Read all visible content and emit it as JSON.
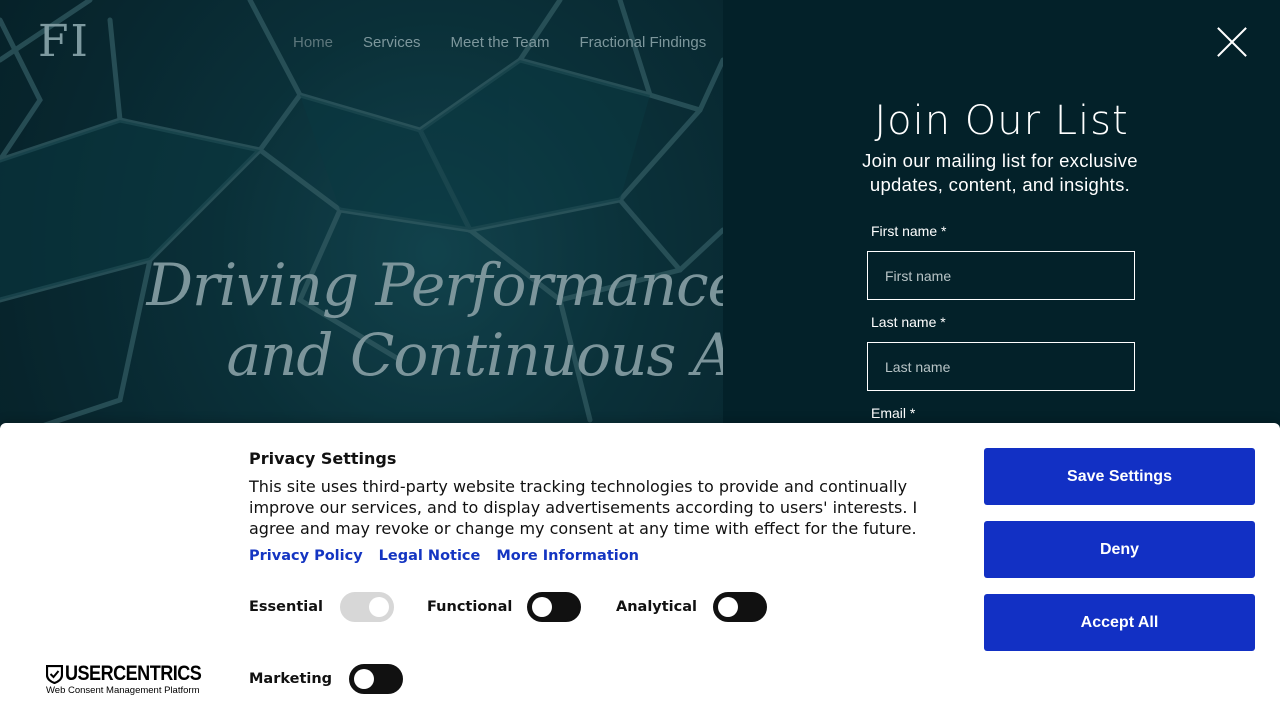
{
  "site": {
    "logo_text": "FI",
    "nav": [
      "Home",
      "Services",
      "Meet the Team",
      "Fractional Findings"
    ],
    "headline_line1": "Driving Performance, T",
    "headline_line2": "and Continuous A"
  },
  "signup": {
    "title": "Join Our List",
    "subtitle": "Join our mailing list for exclusive updates, content, and insights.",
    "first_name_label": "First name *",
    "first_name_placeholder": "First name",
    "last_name_label": "Last name *",
    "last_name_placeholder": "Last name",
    "email_label": "Email *"
  },
  "consent": {
    "title": "Privacy Settings",
    "text": "This site uses third-party website tracking technologies to provide and continually improve our services, and to display advertisements according to users' interests. I agree and may revoke or change my consent at any time with effect for the future.",
    "links": [
      "Privacy Policy",
      "Legal Notice",
      "More Information"
    ],
    "toggles": {
      "essential": {
        "label": "Essential",
        "on": true,
        "disabled": true
      },
      "functional": {
        "label": "Functional",
        "on": false
      },
      "analytical": {
        "label": "Analytical",
        "on": false
      },
      "marketing": {
        "label": "Marketing",
        "on": false
      }
    },
    "buttons": {
      "save": "Save Settings",
      "deny": "Deny",
      "accept": "Accept All"
    },
    "brand": {
      "name": "USERCENTRICS",
      "tagline": "Web Consent Management Platform"
    },
    "accent_color": "#1230c4"
  }
}
